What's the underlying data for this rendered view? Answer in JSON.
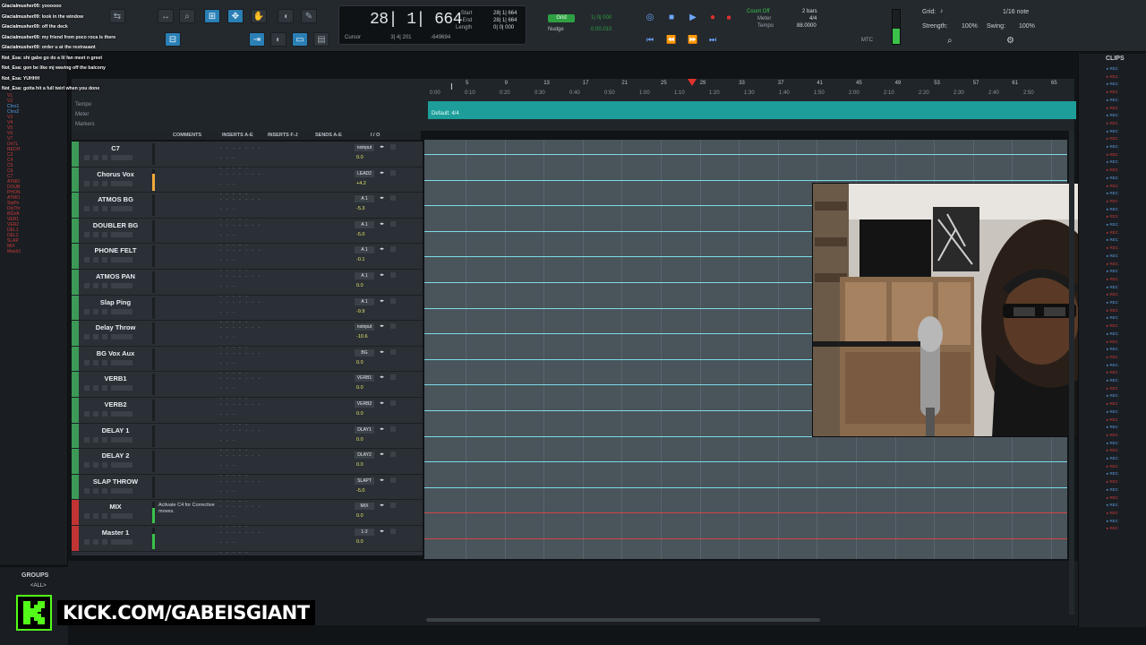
{
  "chat": [
    {
      "user": "Glacialmusher09",
      "msg": "yoooooo"
    },
    {
      "user": "Glacialmusher09",
      "msg": "look in the window"
    },
    {
      "user": "Glacialmusher09",
      "msg": "off the deck"
    },
    {
      "user": "Glacialmusher09",
      "msg": "my friend from poco roca is there"
    },
    {
      "user": "Glacialmusher09",
      "msg": "order u at the restrauant"
    },
    {
      "user": "Not_Esa",
      "msg": "shi gabe go do a lil fan meet n greet"
    },
    {
      "user": "Not_Esa",
      "msg": "gon be like mj waving off the balcony"
    },
    {
      "user": "Not_Esa",
      "msg": "YUHHH"
    },
    {
      "user": "Not_Esa",
      "msg": "gotta hit a full twirl when you done"
    }
  ],
  "toolbar": {
    "counter_main": "28| 1| 664",
    "cursor_label": "Cursor",
    "cursor_value": "3| 4| 201",
    "cursor_neg": "-649694",
    "start_label": "Start",
    "end_label": "End",
    "length_label": "Length",
    "start_val": "28| 1| 664",
    "end_val": "28| 1| 664",
    "length_val": "0| 0| 000",
    "grid_badge": "Grid",
    "grid_value": "1| 0| 000",
    "nudge_label": "Nudge",
    "nudge_value": "0:00.010",
    "count_off": "Count Off",
    "meter_label": "Meter",
    "tempo_label": "Tempo",
    "bars_value": "2 bars",
    "meter_value": "4/4",
    "tempo_value": "88.0000",
    "grid_right_label": "Grid:",
    "grid_right_value": "1/16 note",
    "strength_label": "Strength:",
    "strength_value": "100%",
    "swing_label": "Swing:",
    "swing_value": "100%",
    "mtc_label": "MTC"
  },
  "rulers": {
    "labels": [
      "Tempo",
      "Meter",
      "Markers"
    ],
    "bars": [
      "5",
      "9",
      "13",
      "17",
      "21",
      "25",
      "29",
      "33",
      "37",
      "41",
      "45",
      "49",
      "53",
      "57",
      "61",
      "65"
    ],
    "secs": [
      "0:00",
      "0:10",
      "0:20",
      "0:30",
      "0:40",
      "0:50",
      "1:00",
      "1:10",
      "1:20",
      "1:30",
      "1:40",
      "1:50",
      "2:00",
      "2:10",
      "2:20",
      "2:30",
      "2:40",
      "2:50"
    ],
    "tempo_text": "Default: 4/4"
  },
  "mix_headers": [
    "COMMENTS",
    "INSERTS A-E",
    "INSERTS F-J",
    "SENDS A-E",
    "I / O"
  ],
  "tracks": [
    {
      "name": "C7",
      "color": "green",
      "comment": "",
      "out": "noinput",
      "vol": "0.0",
      "meter": "none"
    },
    {
      "name": "Chorus Vox",
      "color": "green",
      "comment": "",
      "out": "LEAD2",
      "vol": "+4.2",
      "meter": "active"
    },
    {
      "name": "ATMOS BG",
      "color": "green",
      "comment": "",
      "out": "A 1",
      "vol": "-5.3",
      "meter": "none"
    },
    {
      "name": "DOUBLER BG",
      "color": "green",
      "comment": "",
      "out": "A 1",
      "vol": "-5.0",
      "meter": "none"
    },
    {
      "name": "PHONE FELT",
      "color": "green",
      "comment": "",
      "out": "A 1",
      "vol": "-0.1",
      "meter": "none"
    },
    {
      "name": "ATMOS PAN",
      "color": "green",
      "comment": "",
      "out": "A 1",
      "vol": "0.0",
      "meter": "none"
    },
    {
      "name": "Slap Ping",
      "color": "green",
      "comment": "",
      "out": "A 1",
      "vol": "-9.9",
      "meter": "none"
    },
    {
      "name": "Delay Throw",
      "color": "green",
      "comment": "",
      "out": "noinput",
      "vol": "-10.6",
      "meter": "none"
    },
    {
      "name": "BG Vox Aux",
      "color": "green",
      "comment": "",
      "out": "BG",
      "vol": "0.0",
      "meter": "none"
    },
    {
      "name": "VERB1",
      "color": "green",
      "comment": "",
      "out": "VERB1",
      "vol": "0.0",
      "meter": "none"
    },
    {
      "name": "VERB2",
      "color": "green",
      "comment": "",
      "out": "VERB2",
      "vol": "0.0",
      "meter": "none"
    },
    {
      "name": "DELAY 1",
      "color": "green",
      "comment": "",
      "out": "DLAY1",
      "vol": "0.0",
      "meter": "none"
    },
    {
      "name": "DELAY 2",
      "color": "green",
      "comment": "",
      "out": "DLAY2",
      "vol": "0.0",
      "meter": "none"
    },
    {
      "name": "SLAP THROW",
      "color": "green",
      "comment": "",
      "out": "SLAPT",
      "vol": "-5.0",
      "meter": "none"
    },
    {
      "name": "MIX",
      "color": "red",
      "comment": "Activate C4 for Corrective moves.",
      "out": "MIX",
      "vol": "0.0",
      "meter": "green"
    },
    {
      "name": "Master 1",
      "color": "red",
      "comment": "",
      "out": "1-2",
      "vol": "0.0",
      "meter": "green"
    }
  ],
  "track_list": [
    "V1",
    "V2",
    "Chrs1",
    "Chrs2",
    "V3",
    "V4",
    "V5",
    "V6",
    "V7",
    "DnTL",
    "RECH",
    "C2",
    "C4",
    "C5",
    "C6",
    "C7",
    "ATMO",
    "DOUB",
    "PHON",
    "ATMO",
    "SlpPn",
    "DlyThr",
    "BGVA",
    "VER1",
    "VER2",
    "DEL1",
    "DEL2",
    "SLAP",
    "MIX",
    "Mastr1"
  ],
  "groups": {
    "title": "GROUPS",
    "all": "<ALL>"
  },
  "clips": {
    "title": "CLIPS"
  },
  "kick": {
    "text": "KICK.COM/GABEISGIANT"
  },
  "colors": {
    "accent_blue": "#2a7fb5",
    "track_green": "#3c9a56",
    "track_red": "#c23434",
    "tempo_teal": "#1e9e9a",
    "kick_green": "#53fc18"
  }
}
